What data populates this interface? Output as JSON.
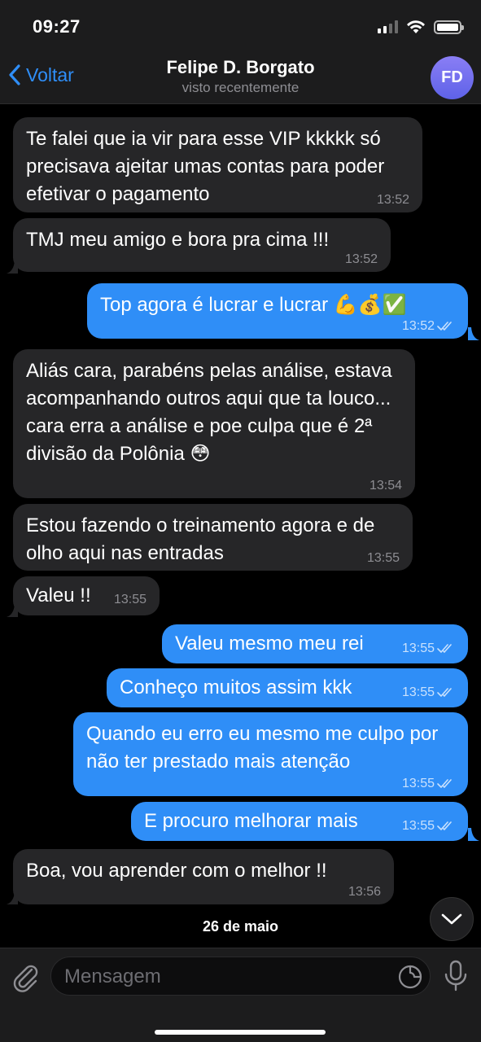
{
  "status": {
    "time": "09:27"
  },
  "header": {
    "back_label": "Voltar",
    "contact_name": "Felipe D. Borgato",
    "contact_status": "visto recentemente",
    "avatar_initials": "FD",
    "accent_color": "#2f8ef7"
  },
  "messages": [
    {
      "dir": "in",
      "text": "Te falei que ia vir para esse VIP kkkkk só precisava ajeitar umas contas para poder efetivar o pagamento",
      "time": "13:52"
    },
    {
      "dir": "in",
      "text": "TMJ meu amigo e bora pra cima !!!",
      "time": "13:52"
    },
    {
      "dir": "out",
      "text": "Top agora é lucrar e lucrar 💪💰✅",
      "time": "13:52",
      "read": true
    },
    {
      "dir": "in",
      "text": "Aliás cara, parabéns pelas análise, estava acompanhando outros aqui que ta louco... cara erra a análise e poe culpa que é 2ª divisão da Polônia 😳",
      "time": "13:54"
    },
    {
      "dir": "in",
      "text": "Estou fazendo o treinamento agora e de olho aqui nas entradas",
      "time": "13:55"
    },
    {
      "dir": "in",
      "text": "Valeu !!",
      "time": "13:55"
    },
    {
      "dir": "out",
      "text": "Valeu mesmo meu rei",
      "time": "13:55",
      "read": true
    },
    {
      "dir": "out",
      "text": "Conheço muitos assim kkk",
      "time": "13:55",
      "read": true
    },
    {
      "dir": "out",
      "text": "Quando eu erro eu mesmo me culpo por não ter prestado mais atenção",
      "time": "13:55",
      "read": true
    },
    {
      "dir": "out",
      "text": "E procuro melhorar mais",
      "time": "13:55",
      "read": true
    },
    {
      "dir": "in",
      "text": "Boa, vou aprender com  o melhor !!",
      "time": "13:56"
    }
  ],
  "date_separator": "26 de maio",
  "input": {
    "placeholder": "Mensagem"
  },
  "icons": [
    "chevron-left-icon",
    "wifi-icon",
    "signal-icon",
    "battery-icon",
    "chevron-down-icon",
    "paperclip-icon",
    "sticker-icon",
    "microphone-icon",
    "double-check-icon"
  ]
}
